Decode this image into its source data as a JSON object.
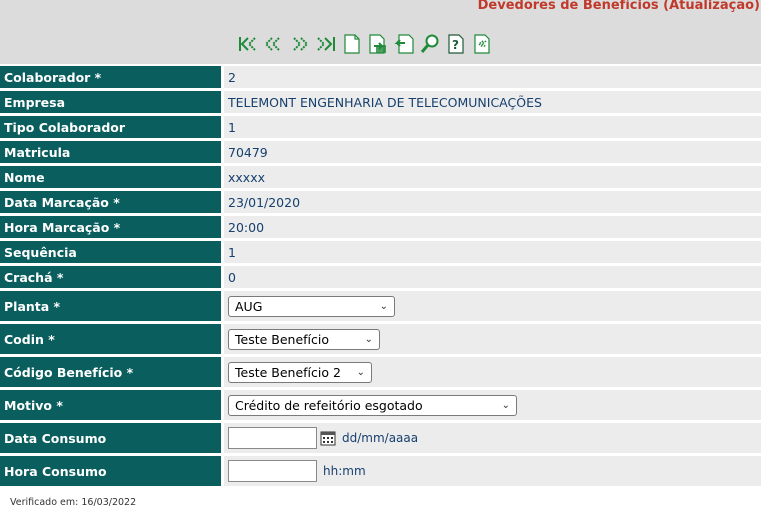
{
  "header": {
    "title": "Devedores de Benefícios (Atualização)"
  },
  "toolbar": {
    "buttons": [
      {
        "icon": "first-record-icon"
      },
      {
        "icon": "previous-record-icon"
      },
      {
        "icon": "next-record-icon"
      },
      {
        "icon": "last-record-icon"
      },
      {
        "icon": "new-record-icon"
      },
      {
        "icon": "save-record-icon"
      },
      {
        "icon": "undo-icon"
      },
      {
        "icon": "search-icon"
      },
      {
        "icon": "help-icon"
      },
      {
        "icon": "back-icon"
      }
    ]
  },
  "form": {
    "colaborador": {
      "label": "Colaborador *",
      "value": "2"
    },
    "empresa": {
      "label": "Empresa",
      "value": "TELEMONT ENGENHARIA DE TELECOMUNICAÇÕES"
    },
    "tipo_colaborador": {
      "label": "Tipo Colaborador",
      "value": "1"
    },
    "matricula": {
      "label": "Matricula",
      "value": "70479"
    },
    "nome": {
      "label": "Nome",
      "value": "xxxxx"
    },
    "data_marcacao": {
      "label": "Data Marcação *",
      "value": "23/01/2020"
    },
    "hora_marcacao": {
      "label": "Hora Marcação *",
      "value": "20:00"
    },
    "sequencia": {
      "label": "Sequência",
      "value": "1"
    },
    "cracha": {
      "label": "Crachá *",
      "value": "0"
    },
    "planta": {
      "label": "Planta *",
      "selected": "AUG"
    },
    "codin": {
      "label": "Codin *",
      "selected": "Teste Benefício"
    },
    "codigo_beneficio": {
      "label": "Código Benefício *",
      "selected": "Teste Benefício 2"
    },
    "motivo": {
      "label": "Motivo *",
      "selected": "Crédito de refeitório esgotado"
    },
    "data_consumo": {
      "label": "Data Consumo",
      "value": "",
      "hint": "dd/mm/aaaa"
    },
    "hora_consumo": {
      "label": "Hora Consumo",
      "value": "",
      "hint": "hh:mm"
    }
  },
  "footer": {
    "verified": "Verificado em: 16/03/2022"
  },
  "colors": {
    "label_bg": "#0b5e5e",
    "value_bg": "#ececec",
    "title": "#c0392b",
    "value_text": "#16406e"
  }
}
